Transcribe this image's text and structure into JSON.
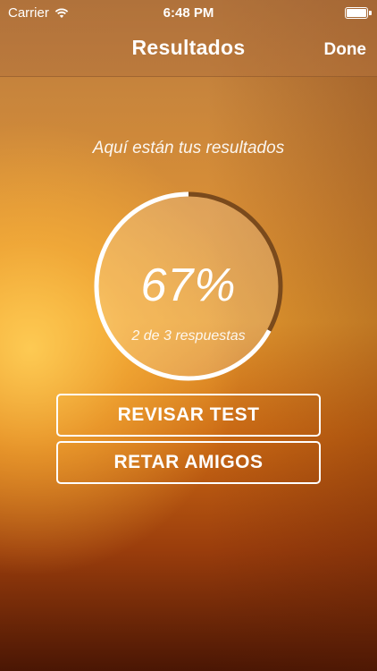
{
  "status_bar": {
    "carrier": "Carrier",
    "time": "6:48 PM",
    "icons": [
      "wifi-icon",
      "battery-icon"
    ]
  },
  "nav": {
    "title": "Resultados",
    "done_label": "Done"
  },
  "results": {
    "subtitle": "Aquí están tus resultados",
    "percent_label": "67%",
    "progress_fraction": 0.67,
    "answers_label": "2 de 3 respuestas"
  },
  "buttons": {
    "review_label": "REVISAR TEST",
    "challenge_label": "RETAR AMIGOS"
  },
  "colors": {
    "ring_progress": "#ffffff",
    "ring_remaining": "#7a4a1c",
    "ring_fill": "#ffffff"
  }
}
